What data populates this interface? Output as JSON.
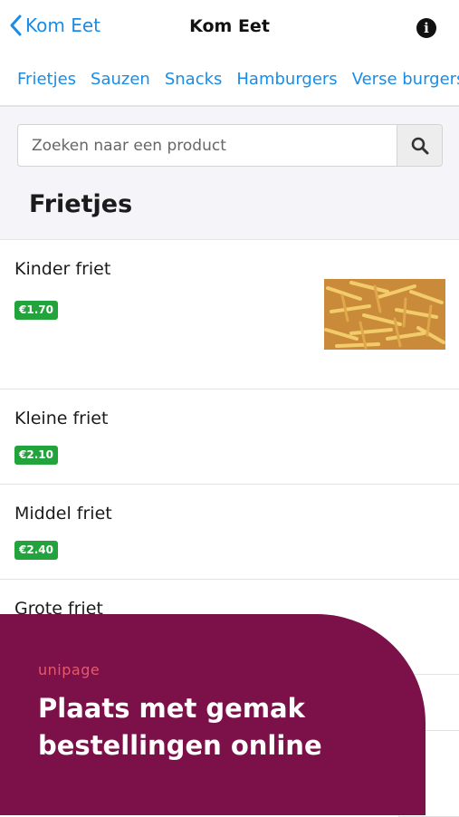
{
  "navbar": {
    "back_label": "Kom Eet",
    "title": "Kom Eet",
    "info_glyph": "i"
  },
  "tabs": [
    {
      "label": "Frietjes"
    },
    {
      "label": "Sauzen"
    },
    {
      "label": "Snacks"
    },
    {
      "label": "Hamburgers"
    },
    {
      "label": "Verse burgers"
    }
  ],
  "search": {
    "placeholder": "Zoeken naar een product",
    "value": ""
  },
  "section": {
    "title": "Frietjes"
  },
  "products": [
    {
      "name": "Kinder friet",
      "price": "€1.70",
      "has_image": true
    },
    {
      "name": "Kleine friet",
      "price": "€2.10"
    },
    {
      "name": "Middel friet",
      "price": "€2.40"
    },
    {
      "name": "Grote friet"
    }
  ],
  "promo": {
    "logo": "unipage",
    "headline": "Plaats met gemak bestellingen online"
  },
  "colors": {
    "accent": "#1a8ce6",
    "price_badge": "#22a33c",
    "promo_bg": "#7c1049",
    "promo_logo": "#e55a6a"
  }
}
